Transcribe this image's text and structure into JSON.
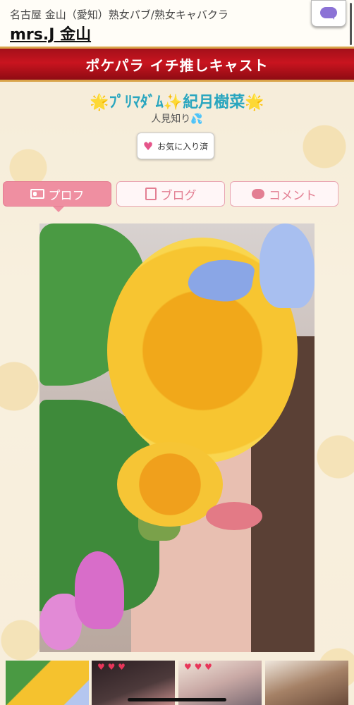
{
  "header": {
    "shop_subtitle": "名古屋 金山（愛知）熟女パブ/熟女キャバクラ",
    "shop_name": "mrs.J 金山"
  },
  "banner": {
    "title": "ポケパラ イチ推しキャスト"
  },
  "cast": {
    "name_star_left": "🌟",
    "name": "ﾌﾟﾘﾏﾀﾞﾑ",
    "name_sparkle": "✨",
    "name_main": "紀月樹菜",
    "name_star_right": "🌟",
    "subtitle": "人見知り",
    "subtitle_emoji": "💦"
  },
  "favorite_button": {
    "label": "お気に入り済"
  },
  "tabs": [
    {
      "label": "プロフ",
      "icon": "profile-card-icon",
      "active": true
    },
    {
      "label": "ブログ",
      "icon": "memo-icon",
      "active": false
    },
    {
      "label": "コメント",
      "icon": "comment-bubble-icon",
      "active": false
    }
  ],
  "colors": {
    "banner_red": "#c9141f",
    "cast_name": "#2aa6bf",
    "tab_active": "#ef8fa1",
    "tab_inactive_text": "#e37f93",
    "chat_icon": "#8b72d6",
    "heart": "#e5558a"
  }
}
